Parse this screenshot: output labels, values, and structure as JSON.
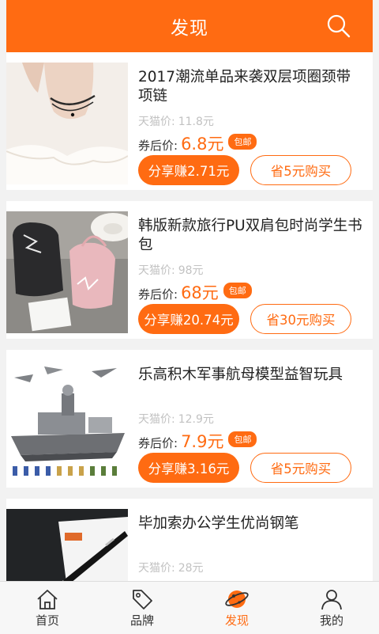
{
  "header": {
    "title": "发现",
    "search_icon": "search-icon"
  },
  "products": [
    {
      "name": "2017潮流单品来袭双层项圈颈带项链",
      "tmall_label": "天猫价:",
      "tmall_price": "11.8元",
      "coupon_label": "券后价:",
      "coupon_price": "6.8元",
      "badge": "包邮",
      "share_label": "分享赚2.71元",
      "buy_label": "省5元购买"
    },
    {
      "name": "韩版新款旅行PU双肩包时尚学生书包",
      "tmall_label": "天猫价:",
      "tmall_price": "98元",
      "coupon_label": "券后价:",
      "coupon_price": "68元",
      "badge": "包邮",
      "share_label": "分享赚20.74元",
      "buy_label": "省30元购买"
    },
    {
      "name": "乐高积木军事航母模型益智玩具",
      "tmall_label": "天猫价:",
      "tmall_price": "12.9元",
      "coupon_label": "券后价:",
      "coupon_price": "7.9元",
      "badge": "包邮",
      "share_label": "分享赚3.16元",
      "buy_label": "省5元购买"
    },
    {
      "name": "毕加索办公学生优尚钢笔",
      "tmall_label": "天猫价:",
      "tmall_price": "28元"
    }
  ],
  "tabs": [
    {
      "label": "首页",
      "icon": "home-icon"
    },
    {
      "label": "品牌",
      "icon": "tag-icon"
    },
    {
      "label": "发现",
      "icon": "planet-icon",
      "active": true
    },
    {
      "label": "我的",
      "icon": "user-icon"
    }
  ],
  "colors": {
    "accent": "#ff6b12",
    "muted": "#c2c2c2",
    "background": "#f2f2f2"
  }
}
